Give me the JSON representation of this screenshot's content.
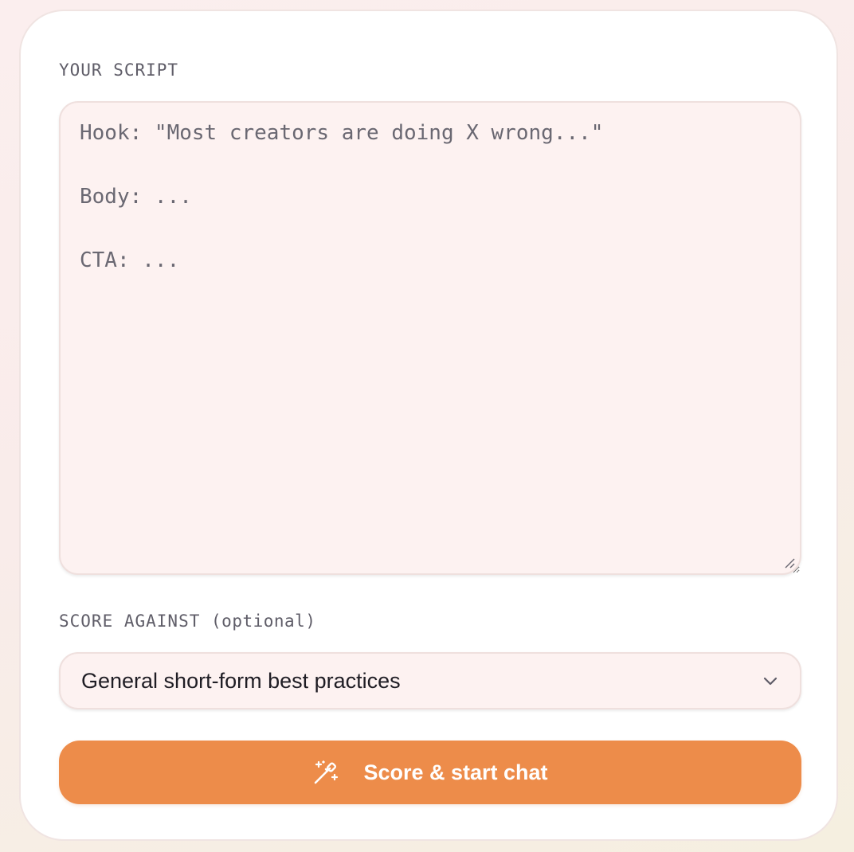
{
  "script_section": {
    "label": "YOUR SCRIPT",
    "lines": [
      "Hook: \"Most creators are doing X wrong...\"",
      "",
      "Body: ...",
      "",
      "CTA: ..."
    ]
  },
  "score_section": {
    "label": "SCORE AGAINST",
    "optional_label": "(optional)",
    "selected_option": "General short-form best practices",
    "chevron_icon": "chevron-down-icon"
  },
  "submit": {
    "label": "Score & start chat",
    "icon": "magic-wand-icon",
    "color": "#ed8c4a"
  }
}
